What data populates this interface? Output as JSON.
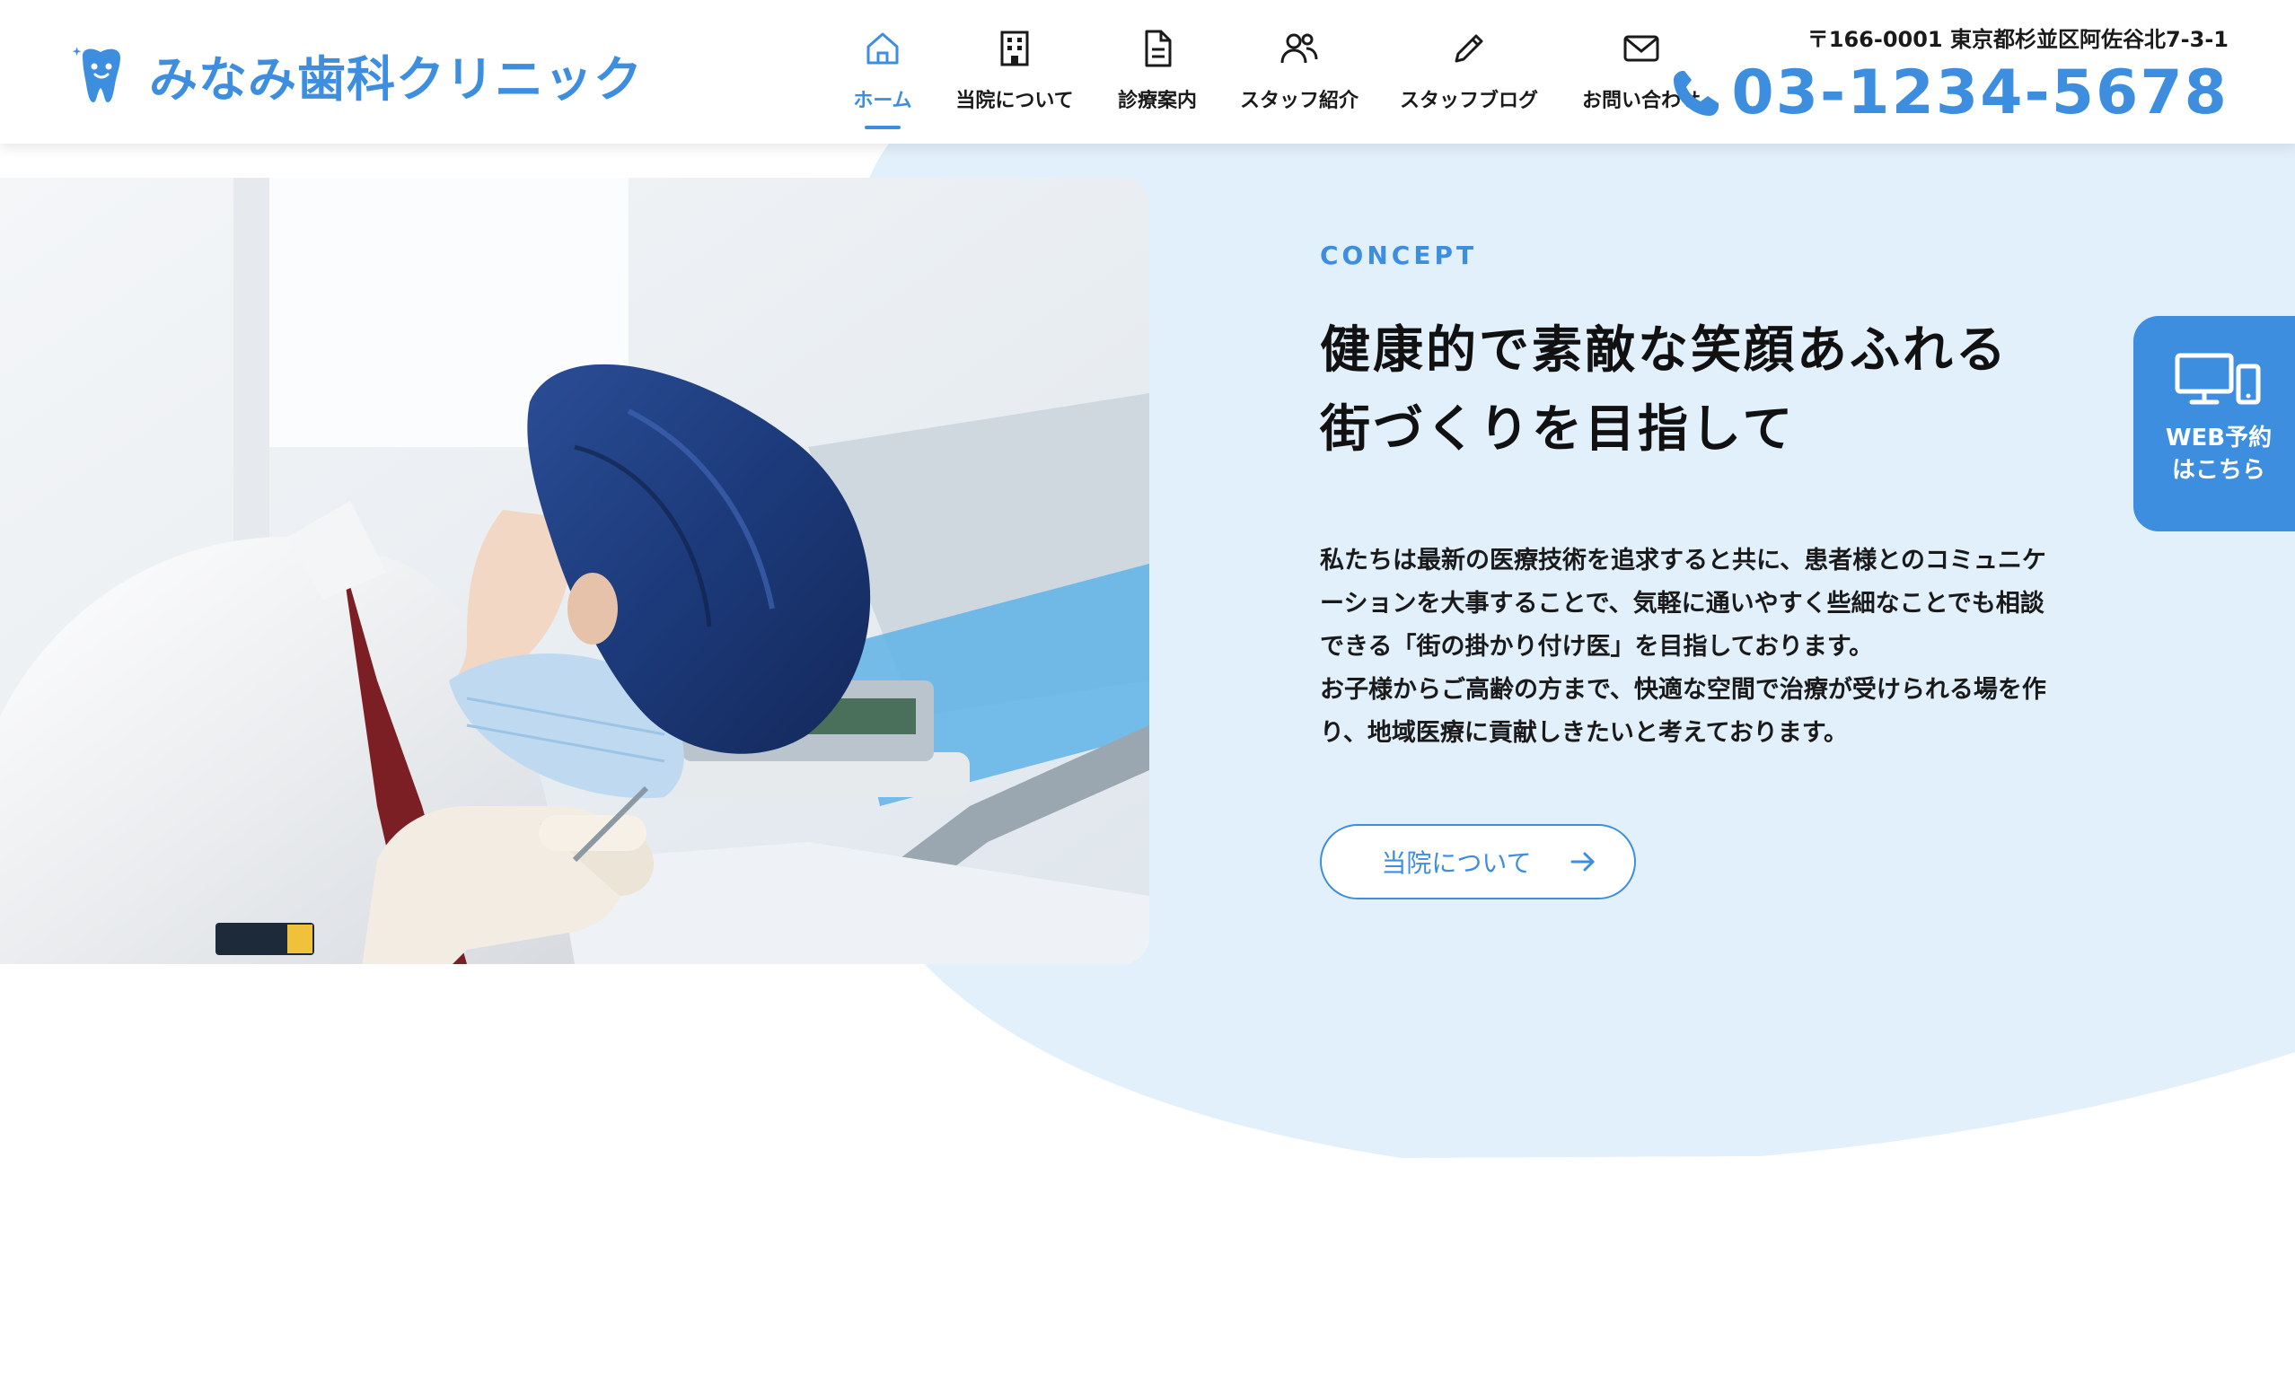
{
  "brand": {
    "name": "みなみ歯科クリニック",
    "accent": "#3e8ee0",
    "background": "#e2f0fc"
  },
  "nav": [
    {
      "label": "ホーム",
      "icon": "home-icon",
      "active": true
    },
    {
      "label": "当院について",
      "icon": "building-icon",
      "active": false
    },
    {
      "label": "診療案内",
      "icon": "document-icon",
      "active": false
    },
    {
      "label": "スタッフ紹介",
      "icon": "users-icon",
      "active": false
    },
    {
      "label": "スタッフブログ",
      "icon": "pencil-icon",
      "active": false
    },
    {
      "label": "お問い合わせ",
      "icon": "mail-icon",
      "active": false
    }
  ],
  "contact": {
    "address": "〒166-0001 東京都杉並区阿佐谷北7-3-1",
    "phone": "03-1234-5678"
  },
  "concept": {
    "label": "CONCEPT",
    "title": "健康的で素敵な笑顔あふれる\n街づくりを目指して",
    "body": "私たちは最新の医療技術を追求すると共に、患者様とのコミュニケーションを大事することで、気軽に通いやすく些細なことでも相談できる「街の掛かり付け医」を目指しております。\nお子様からご高齢の方まで、快適な空間で治療が受けられる場を作り、地域医療に貢献しきたいと考えております。",
    "button_label": "当院について"
  },
  "side_tab": {
    "label": "WEB予約\nはこちら",
    "icon": "devices-icon"
  },
  "hero_image": {
    "subject": "dentist in surgical cap and mask treating a patient"
  }
}
